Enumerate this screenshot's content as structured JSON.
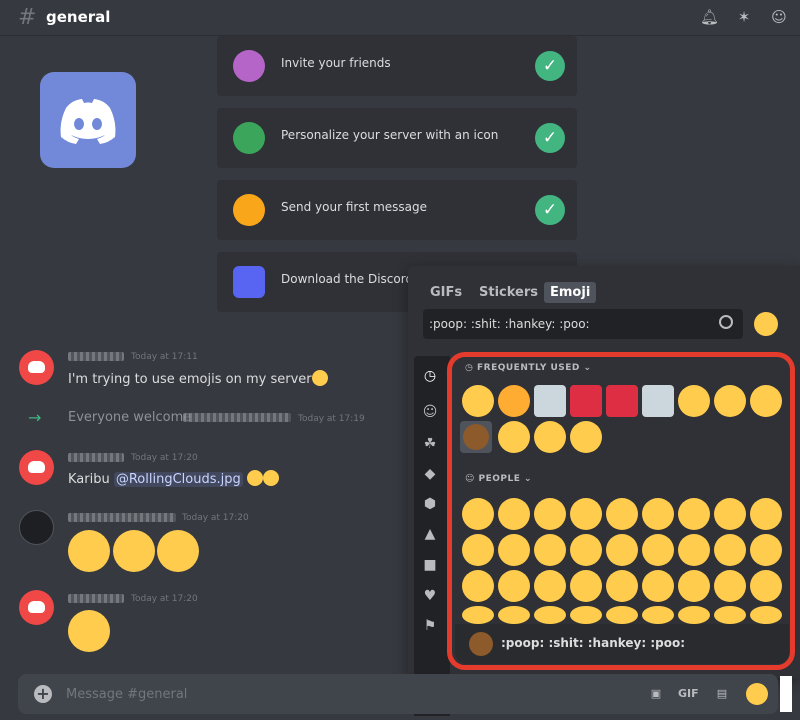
{
  "header": {
    "channel": "general",
    "hash": "#"
  },
  "cards": [
    {
      "text": "Invite your friends"
    },
    {
      "text": "Personalize your server with an icon"
    },
    {
      "text": "Send your first message"
    },
    {
      "text": "Download the Discord A"
    }
  ],
  "messages": [
    {
      "timestamp": "Today at 17:11",
      "text": "I'm trying to use emojis on my server"
    },
    {
      "text": "Everyone welcome",
      "timestamp": "Today at 17:19"
    },
    {
      "timestamp": "Today at 17:20",
      "text_prefix": "Karibu ",
      "mention": "@RollingClouds.jpg"
    },
    {
      "timestamp": "Today at 17:20"
    },
    {
      "timestamp": "Today at 17:20"
    }
  ],
  "picker": {
    "tabs": [
      "GIFs",
      "Stickers",
      "Emoji"
    ],
    "search_value": ":poop: :shit: :hankey: :poo:",
    "sections": {
      "frequent": "FREQUENTLY USED",
      "people": "PEOPLE"
    },
    "footer_name": ":poop: :shit: :hankey: :poo:"
  },
  "composer": {
    "placeholder": "Message #general",
    "gif_label": "GIF"
  },
  "colors": {
    "accent": "#7289da",
    "highlight": "#e53b2c",
    "success": "#43b581"
  }
}
